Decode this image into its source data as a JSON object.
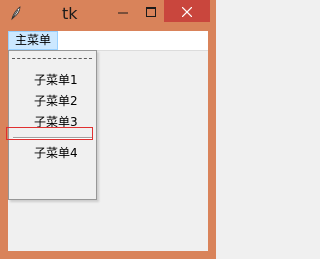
{
  "window": {
    "title": "tk"
  },
  "menubar": {
    "items": [
      {
        "label": "主菜单"
      }
    ]
  },
  "dropdown": {
    "items": [
      {
        "label": "子菜单1"
      },
      {
        "label": "子菜单2"
      },
      {
        "label": "子菜单3"
      },
      {
        "label": "子菜单4"
      }
    ]
  },
  "icons": {
    "app": "feather-icon",
    "minimize": "minimize-icon",
    "maximize": "maximize-icon",
    "close": "close-icon"
  },
  "colors": {
    "titlebar": "#d9835a",
    "close_button": "#c9463d",
    "menu_selected": "#cce8ff",
    "annotation": "#e03030"
  }
}
